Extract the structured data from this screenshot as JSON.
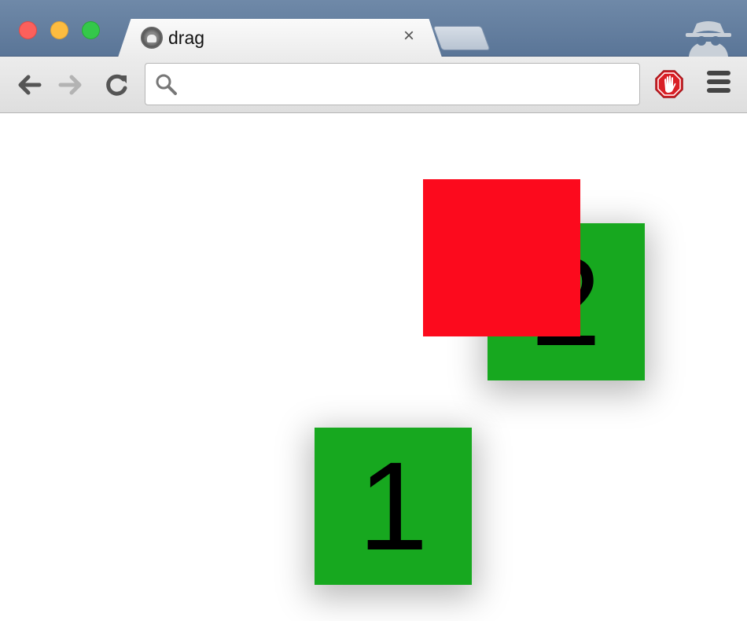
{
  "browser": {
    "tab": {
      "title": "drag",
      "close_glyph": "×"
    },
    "omnibox": {
      "value": "",
      "placeholder": ""
    },
    "icons": {
      "back": "arrow-left",
      "forward": "arrow-right",
      "reload": "reload",
      "search": "magnifier",
      "extension": "adblock-stop-hand",
      "menu": "hamburger",
      "incognito": "incognito-spy"
    }
  },
  "page": {
    "boxes": [
      {
        "label": "1",
        "color": "#17a81f"
      },
      {
        "label": "2",
        "color": "#17a81f"
      },
      {
        "label": "",
        "color": "#fc0a1d"
      }
    ]
  }
}
